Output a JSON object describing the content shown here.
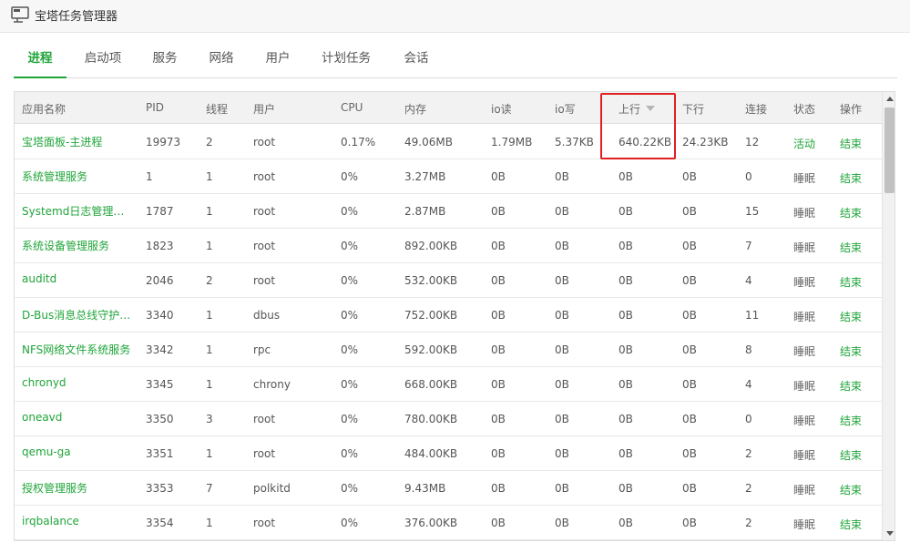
{
  "window": {
    "title": "宝塔任务管理器",
    "icon": "monitor-icon"
  },
  "tabs": [
    {
      "label": "进程",
      "active": true
    },
    {
      "label": "启动项",
      "active": false
    },
    {
      "label": "服务",
      "active": false
    },
    {
      "label": "网络",
      "active": false
    },
    {
      "label": "用户",
      "active": false
    },
    {
      "label": "计划任务",
      "active": false
    },
    {
      "label": "会话",
      "active": false
    }
  ],
  "table": {
    "columns": [
      "应用名称",
      "PID",
      "线程",
      "用户",
      "CPU",
      "内存",
      "io读",
      "io写",
      "上行",
      "下行",
      "连接",
      "状态",
      "操作"
    ],
    "sorted_by": "上行",
    "sort_direction": "desc",
    "rows": [
      [
        "宝塔面板-主进程",
        "19973",
        "2",
        "root",
        "0.17%",
        "49.06MB",
        "1.79MB",
        "5.37KB",
        "640.22KB",
        "24.23KB",
        "12",
        "活动",
        "结束"
      ],
      [
        "系统管理服务",
        "1",
        "1",
        "root",
        "0%",
        "3.27MB",
        "0B",
        "0B",
        "0B",
        "0B",
        "0",
        "睡眠",
        "结束"
      ],
      [
        "Systemd日志管理服务",
        "1787",
        "1",
        "root",
        "0%",
        "2.87MB",
        "0B",
        "0B",
        "0B",
        "0B",
        "15",
        "睡眠",
        "结束"
      ],
      [
        "系统设备管理服务",
        "1823",
        "1",
        "root",
        "0%",
        "892.00KB",
        "0B",
        "0B",
        "0B",
        "0B",
        "7",
        "睡眠",
        "结束"
      ],
      [
        "auditd",
        "2046",
        "2",
        "root",
        "0%",
        "532.00KB",
        "0B",
        "0B",
        "0B",
        "0B",
        "4",
        "睡眠",
        "结束"
      ],
      [
        "D-Bus消息总线守护进程",
        "3340",
        "1",
        "dbus",
        "0%",
        "752.00KB",
        "0B",
        "0B",
        "0B",
        "0B",
        "11",
        "睡眠",
        "结束"
      ],
      [
        "NFS网络文件系统服务",
        "3342",
        "1",
        "rpc",
        "0%",
        "592.00KB",
        "0B",
        "0B",
        "0B",
        "0B",
        "8",
        "睡眠",
        "结束"
      ],
      [
        "chronyd",
        "3345",
        "1",
        "chrony",
        "0%",
        "668.00KB",
        "0B",
        "0B",
        "0B",
        "0B",
        "4",
        "睡眠",
        "结束"
      ],
      [
        "oneavd",
        "3350",
        "3",
        "root",
        "0%",
        "780.00KB",
        "0B",
        "0B",
        "0B",
        "0B",
        "0",
        "睡眠",
        "结束"
      ],
      [
        "qemu-ga",
        "3351",
        "1",
        "root",
        "0%",
        "484.00KB",
        "0B",
        "0B",
        "0B",
        "0B",
        "2",
        "睡眠",
        "结束"
      ],
      [
        "授权管理服务",
        "3353",
        "7",
        "polkitd",
        "0%",
        "9.43MB",
        "0B",
        "0B",
        "0B",
        "0B",
        "2",
        "睡眠",
        "结束"
      ],
      [
        "irqbalance",
        "3354",
        "1",
        "root",
        "0%",
        "376.00KB",
        "0B",
        "0B",
        "0B",
        "0B",
        "2",
        "睡眠",
        "结束"
      ]
    ]
  },
  "colors": {
    "accent": "#20a53a",
    "highlight": "#e02020"
  },
  "icons": {
    "sort": "caret-down-icon",
    "scroll_up": "arrow-up-icon",
    "scroll_down": "arrow-down-icon"
  }
}
